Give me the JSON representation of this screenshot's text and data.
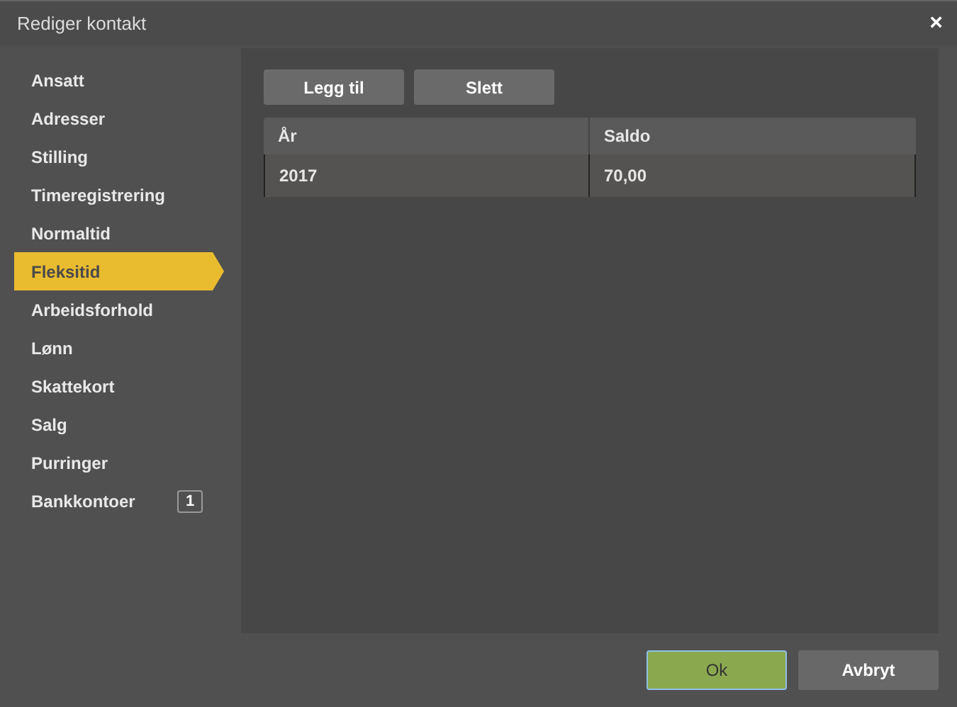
{
  "window": {
    "title": "Rediger kontakt",
    "close": "×"
  },
  "sidebar": {
    "items": [
      {
        "label": "Ansatt",
        "selected": false
      },
      {
        "label": "Adresser",
        "selected": false
      },
      {
        "label": "Stilling",
        "selected": false
      },
      {
        "label": "Timeregistrering",
        "selected": false
      },
      {
        "label": "Normaltid",
        "selected": false
      },
      {
        "label": "Fleksitid",
        "selected": true
      },
      {
        "label": "Arbeidsforhold",
        "selected": false
      },
      {
        "label": "Lønn",
        "selected": false
      },
      {
        "label": "Skattekort",
        "selected": false
      },
      {
        "label": "Salg",
        "selected": false
      },
      {
        "label": "Purringer",
        "selected": false
      },
      {
        "label": "Bankkontoer",
        "selected": false,
        "badge": "1"
      }
    ]
  },
  "toolbar": [
    "Legg til",
    "Slett"
  ],
  "table": {
    "columns": [
      "År",
      "Saldo"
    ],
    "rows": [
      [
        "2017",
        "70,00"
      ]
    ]
  },
  "buttons": [
    {
      "label": "Ok",
      "kind": "primary"
    },
    {
      "label": "Avbryt",
      "kind": "secondary"
    }
  ]
}
